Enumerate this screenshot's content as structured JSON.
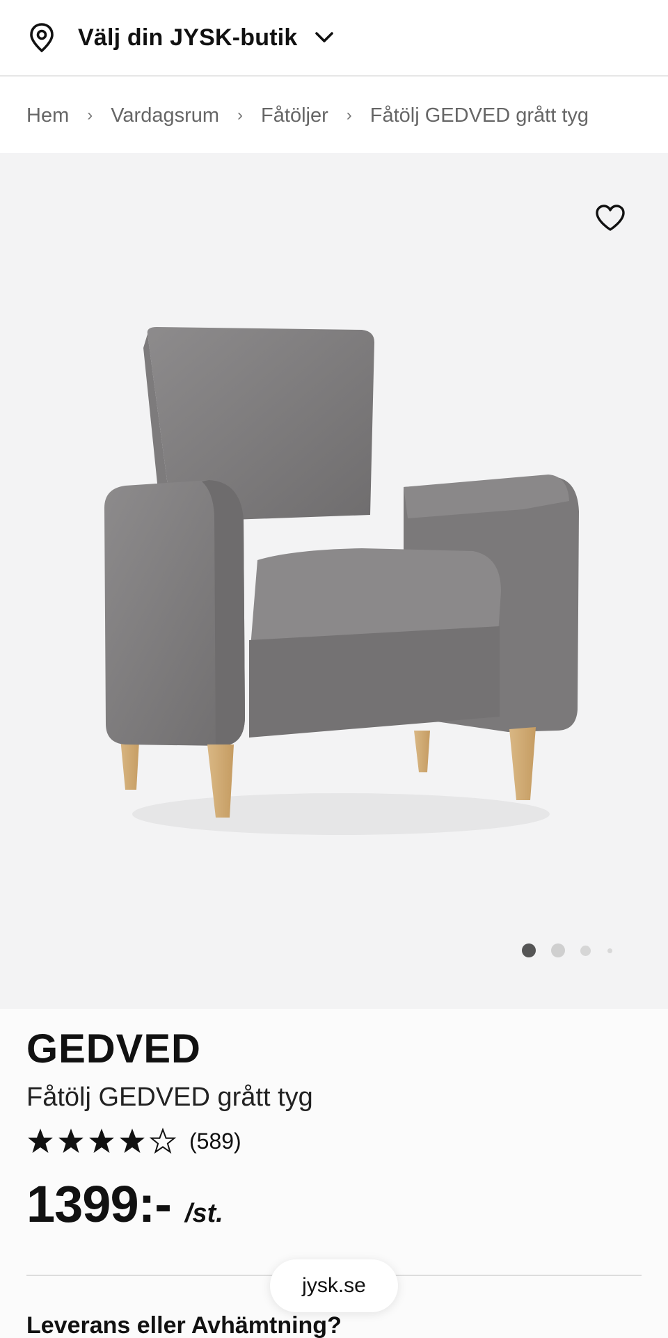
{
  "store_bar": {
    "icon": "location-pin-icon",
    "label": "Välj din JYSK-butik",
    "chevron": "chevron-down-icon"
  },
  "breadcrumb": {
    "items": [
      "Hem",
      "Vardagsrum",
      "Fåtöljer",
      "Fåtölj GEDVED grått tyg"
    ],
    "separator": "›"
  },
  "gallery": {
    "favorite_icon": "heart-outline-icon",
    "image_alt": "Gray fabric armchair with wooden legs",
    "slides_total": 4,
    "active_slide": 1
  },
  "product": {
    "brand": "GEDVED",
    "name": "Fåtölj GEDVED grått tyg",
    "rating": {
      "stars": 4,
      "max": 5,
      "count_text": "(589)"
    },
    "price": "1399:-",
    "price_unit": "/st."
  },
  "delivery": {
    "heading": "Leverans eller Avhämtning?"
  },
  "browser": {
    "url": "jysk.se"
  },
  "colors": {
    "gallery_bg": "#f3f3f4",
    "text": "#111111",
    "muted": "#666666"
  }
}
